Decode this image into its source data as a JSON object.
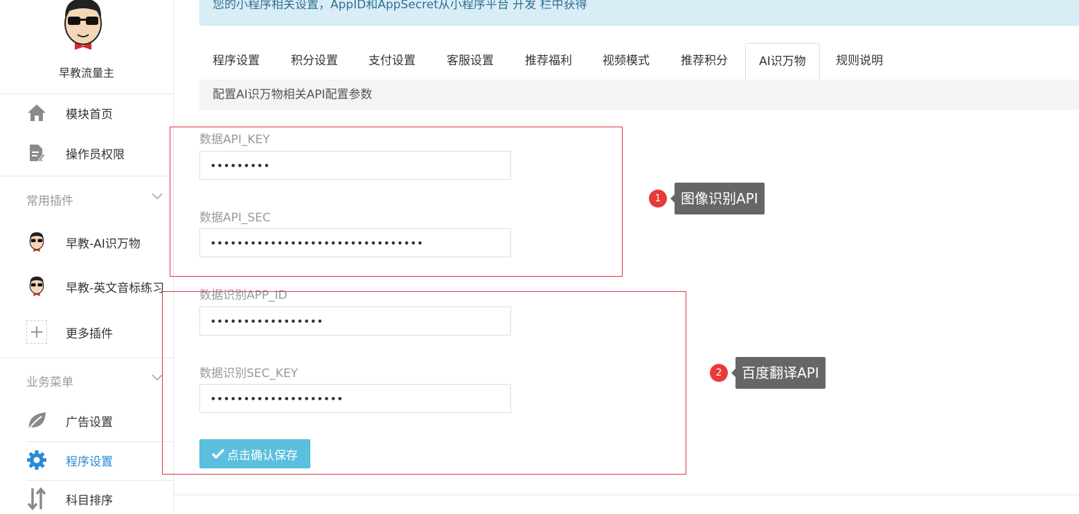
{
  "sidebar": {
    "brand": "早教流量主",
    "menu": [
      {
        "label": "模块首页",
        "icon": "home-icon"
      },
      {
        "label": "操作员权限",
        "icon": "document-edit-icon"
      }
    ],
    "plugins_group": {
      "title": "常用插件",
      "items": [
        {
          "label": "早教-AI识万物",
          "icon": "cartoon-avatar-icon"
        },
        {
          "label": "早教-英文音标练习",
          "icon": "cartoon-avatar-icon"
        },
        {
          "label": "更多插件",
          "icon": "plus-icon"
        }
      ]
    },
    "business_group": {
      "title": "业务菜单",
      "items": [
        {
          "label": "广告设置",
          "icon": "leaf-icon"
        },
        {
          "label": "程序设置",
          "icon": "gear-icon",
          "active": true
        },
        {
          "label": "科目排序",
          "icon": "sort-arrows-icon"
        }
      ]
    }
  },
  "alert": {
    "text": "您的小程序相关设置，AppID和AppSecret从小程序平台 开发 栏中获得"
  },
  "tabs": [
    {
      "label": "程序设置"
    },
    {
      "label": "积分设置"
    },
    {
      "label": "支付设置"
    },
    {
      "label": "客服设置"
    },
    {
      "label": "推荐福利"
    },
    {
      "label": "视频模式"
    },
    {
      "label": "推荐积分"
    },
    {
      "label": "AI识万物",
      "active": true
    },
    {
      "label": "规则说明"
    }
  ],
  "description": "配置AI识万物相关API配置参数",
  "form": {
    "fields": [
      {
        "label": "数据API_KEY",
        "value": "•••••••••"
      },
      {
        "label": "数据API_SEC",
        "value": "••••••••••••••••••••••••••••••••"
      },
      {
        "label": "数据识别APP_ID",
        "value": "•••••••••••••••••"
      },
      {
        "label": "数据识别SEC_KEY",
        "value": "••••••••••••••••••••"
      }
    ],
    "save_label": "点击确认保存"
  },
  "annotations": [
    {
      "number": "1",
      "text": "图像识别API"
    },
    {
      "number": "2",
      "text": "百度翻译API"
    }
  ],
  "colors": {
    "accent": "#2a8ad3",
    "alert_bg": "#d9edf7",
    "save_button": "#5bc0de",
    "annotation_red": "#d9363e",
    "tooltip_bg": "#666666"
  }
}
